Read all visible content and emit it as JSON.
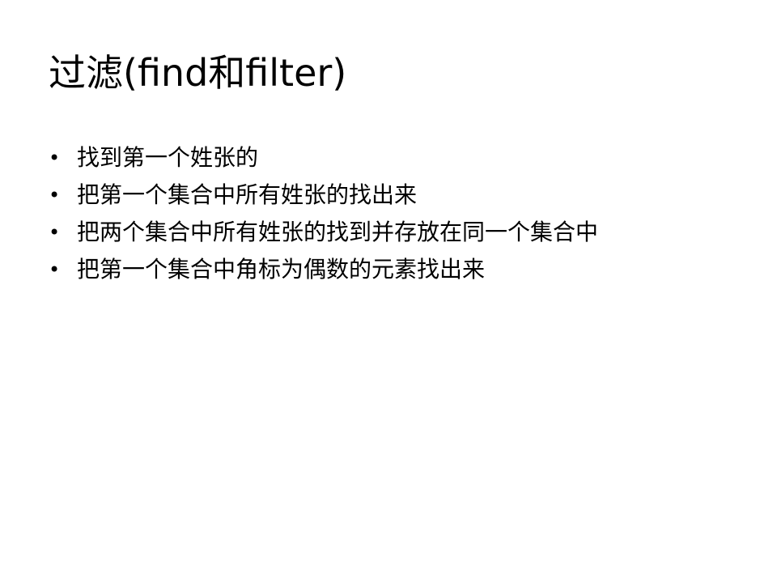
{
  "slide": {
    "title": "过滤(find和filter)",
    "bullets": [
      "找到第一个姓张的",
      "把第一个集合中所有姓张的找出来",
      "把两个集合中所有姓张的找到并存放在同一个集合中",
      "把第一个集合中角标为偶数的元素找出来"
    ],
    "bullet_symbol": "•"
  }
}
